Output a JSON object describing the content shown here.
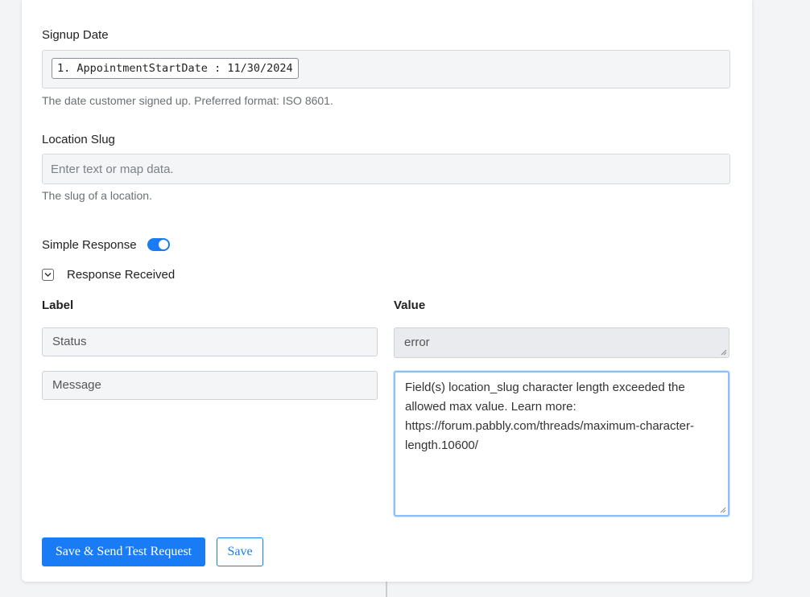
{
  "form": {
    "cut_off_text": "The ... ...",
    "signup_date": {
      "label": "Signup Date",
      "mapped_chip": "1. AppointmentStartDate : 11/30/2024",
      "help": "The date customer signed up. Preferred format: ISO 8601."
    },
    "location_slug": {
      "label": "Location Slug",
      "placeholder": "Enter text or map data.",
      "value": "",
      "help": "The slug of a location."
    },
    "simple_response": {
      "label": "Simple Response",
      "enabled": true
    }
  },
  "response": {
    "toggle_label": "Response Received",
    "columns": {
      "label": "Label",
      "value": "Value"
    },
    "rows": [
      {
        "label": "Status",
        "value": "error"
      },
      {
        "label": "Message",
        "value": "Field(s) location_slug character length exceeded the allowed max value. Learn more: https://forum.pabbly.com/threads/maximum-character-length.10600/"
      }
    ]
  },
  "actions": {
    "save_and_send_label": "Save & Send Test Request",
    "save_label": "Save"
  },
  "colors": {
    "primary": "#1a7cf5",
    "focus_border": "#8ec0f6",
    "input_bg": "#f4f5f7"
  }
}
